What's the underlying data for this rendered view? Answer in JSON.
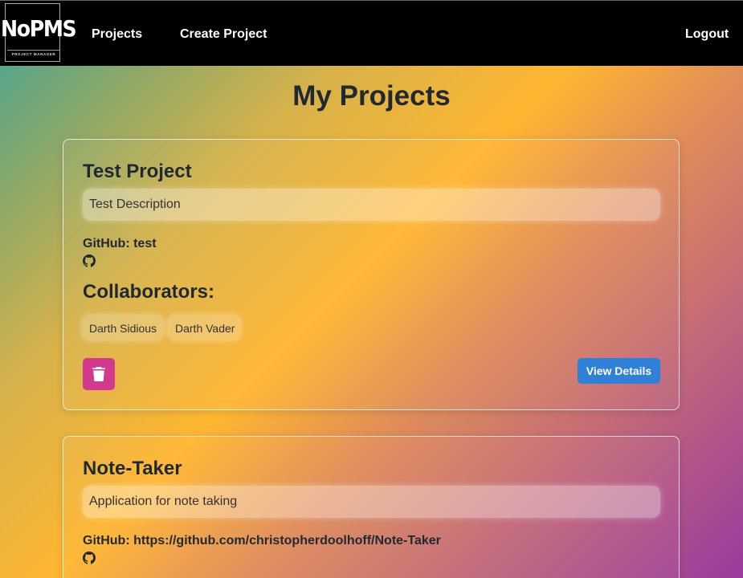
{
  "nav": {
    "logo_main": "NoPMS",
    "logo_sub": "PROJECT MANAGER",
    "links": [
      "Projects",
      "Create Project"
    ],
    "logout": "Logout"
  },
  "page_title": "My Projects",
  "projects": [
    {
      "title": "Test Project",
      "description": "Test Description",
      "github": "GitHub: test",
      "collaborators_heading": "Collaborators:",
      "collaborators": [
        "Darth Sidious",
        "Darth Vader"
      ],
      "view_details": "View Details"
    },
    {
      "title": "Note-Taker",
      "description": "Application for note taking",
      "github": "GitHub: https://github.com/christopherdoolhoff/Note-Taker"
    }
  ],
  "colors": {
    "navbar": "#000000",
    "delete_button": "#d33a8e",
    "view_button": "#2f80d8"
  },
  "icons": [
    "github-icon",
    "trash-icon"
  ]
}
